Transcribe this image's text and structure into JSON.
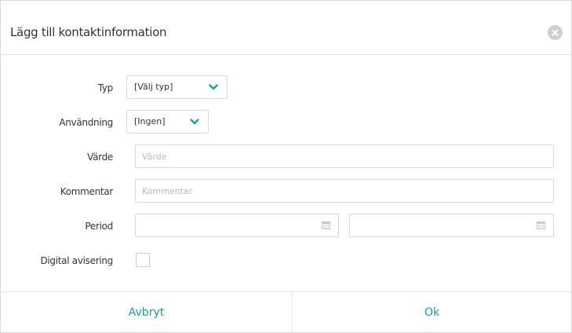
{
  "dialog": {
    "title": "Lägg till kontaktinformation",
    "close_icon": "close-icon"
  },
  "form": {
    "type": {
      "label": "Typ",
      "selected": "[Välj typ]",
      "icon": "chevron-down-icon"
    },
    "usage": {
      "label": "Användning",
      "selected": "[Ingen]",
      "icon": "chevron-down-icon"
    },
    "value": {
      "label": "Värde",
      "placeholder": "Värde",
      "value": ""
    },
    "comment": {
      "label": "Kommentar",
      "placeholder": "Kommentar",
      "value": ""
    },
    "period": {
      "label": "Period",
      "start": "",
      "end": "",
      "icon": "calendar-icon"
    },
    "digital_notice": {
      "label": "Digital avisering",
      "checked": false
    }
  },
  "footer": {
    "cancel_label": "Avbryt",
    "ok_label": "Ok"
  },
  "colors": {
    "accent": "#1a9e9a",
    "border": "#d9d9d9",
    "close_bg": "#cfcfcf"
  }
}
